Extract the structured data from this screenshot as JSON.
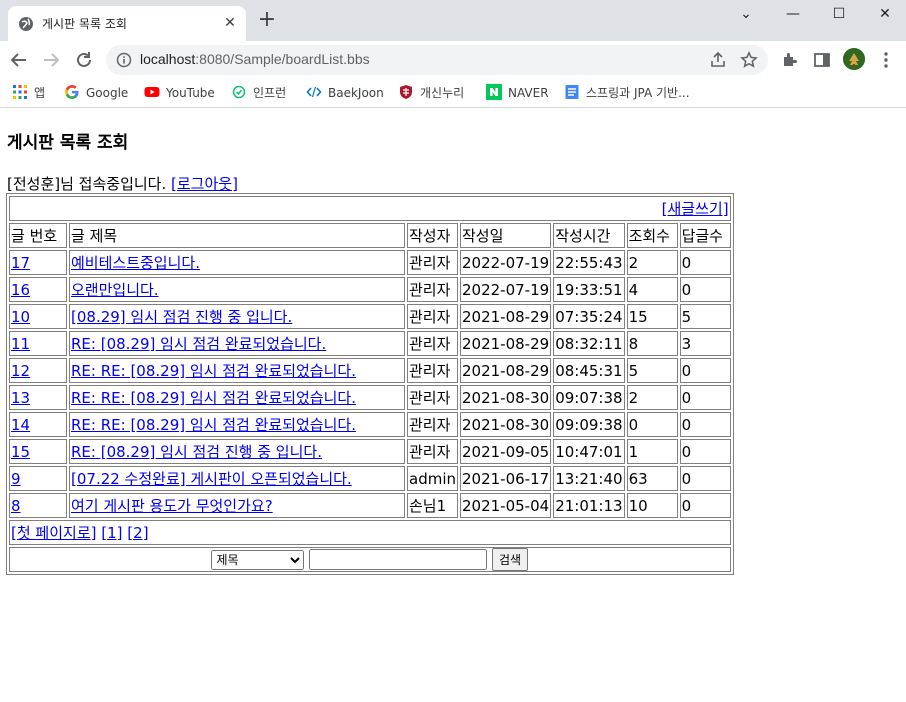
{
  "browser": {
    "tab_title": "게시판 목록 조회",
    "tab_close": "✕",
    "new_tab": "+",
    "window": {
      "minimize": "—",
      "maximize": "☐",
      "close": "✕",
      "collapse": "⌄"
    },
    "url_host": "localhost",
    "url_rest": ":8080/Sample/boardList.bbs",
    "bookmarks": [
      {
        "label": "앱",
        "icon": "apps-grid-icon"
      },
      {
        "label": "Google",
        "icon": "google-icon"
      },
      {
        "label": "YouTube",
        "icon": "youtube-icon"
      },
      {
        "label": "인프런",
        "icon": "inflearn-icon"
      },
      {
        "label": "BaekJoon",
        "icon": "code-icon"
      },
      {
        "label": "개신누리",
        "icon": "shield-icon"
      },
      {
        "label": "NAVER",
        "icon": "naver-icon"
      },
      {
        "label": "스프링과 JPA 기반...",
        "icon": "doc-icon"
      }
    ]
  },
  "page": {
    "title": "게시판 목록 조회",
    "user_greeting": "[전성훈]님 접속중입니다.",
    "logout_link": "[로그아웃]",
    "write_link": "[새글쓰기]",
    "headers": [
      "글 번호",
      "글 제목",
      "작성자",
      "작성일",
      "작성시간",
      "조회수",
      "답글수"
    ],
    "rows": [
      {
        "no": "17",
        "title": "예비테스트중입니다.",
        "indent": 0,
        "author": "관리자",
        "date": "2022-07-19",
        "time": "22:55:43",
        "hits": "2",
        "replies": "0"
      },
      {
        "no": "16",
        "title": "오랜만입니다.",
        "indent": 0,
        "author": "관리자",
        "date": "2022-07-19",
        "time": "19:33:51",
        "hits": "4",
        "replies": "0"
      },
      {
        "no": "10",
        "title": "[08.29] 임시 점검 진행 중 입니다.",
        "indent": 0,
        "author": "관리자",
        "date": "2021-08-29",
        "time": "07:35:24",
        "hits": "15",
        "replies": "5"
      },
      {
        "no": "11",
        "title": "RE: [08.29] 임시 점검 완료되었습니다.",
        "indent": 1,
        "author": "관리자",
        "date": "2021-08-29",
        "time": "08:32:11",
        "hits": "8",
        "replies": "3"
      },
      {
        "no": "12",
        "title": "RE: RE: [08.29] 임시 점검 완료되었습니다.",
        "indent": 2,
        "author": "관리자",
        "date": "2021-08-29",
        "time": "08:45:31",
        "hits": "5",
        "replies": "0"
      },
      {
        "no": "13",
        "title": "RE: RE: [08.29] 임시 점검 완료되었습니다.",
        "indent": 2,
        "author": "관리자",
        "date": "2021-08-30",
        "time": "09:07:38",
        "hits": "2",
        "replies": "0"
      },
      {
        "no": "14",
        "title": "RE: RE: [08.29] 임시 점검 완료되었습니다.",
        "indent": 2,
        "author": "관리자",
        "date": "2021-08-30",
        "time": "09:09:38",
        "hits": "0",
        "replies": "0"
      },
      {
        "no": "15",
        "title": "RE: [08.29] 임시 점검 진행 중 입니다.",
        "indent": 1,
        "author": "관리자",
        "date": "2021-09-05",
        "time": "10:47:01",
        "hits": "1",
        "replies": "0"
      },
      {
        "no": "9",
        "title": "[07.22 수정완료] 게시판이 오픈되었습니다.",
        "indent": 0,
        "author": "admin",
        "date": "2021-06-17",
        "time": "13:21:40",
        "hits": "63",
        "replies": "0"
      },
      {
        "no": "8",
        "title": "여기 게시판 용도가 무엇인가요?",
        "indent": 0,
        "author": "손님1",
        "date": "2021-05-04",
        "time": "21:01:13",
        "hits": "10",
        "replies": "0"
      }
    ],
    "pagination": {
      "first": "[첫 페이지로]",
      "pages": [
        "[1]",
        "[2]"
      ]
    },
    "search": {
      "field_selected": "제목",
      "keyword": "",
      "button": "검색"
    }
  }
}
